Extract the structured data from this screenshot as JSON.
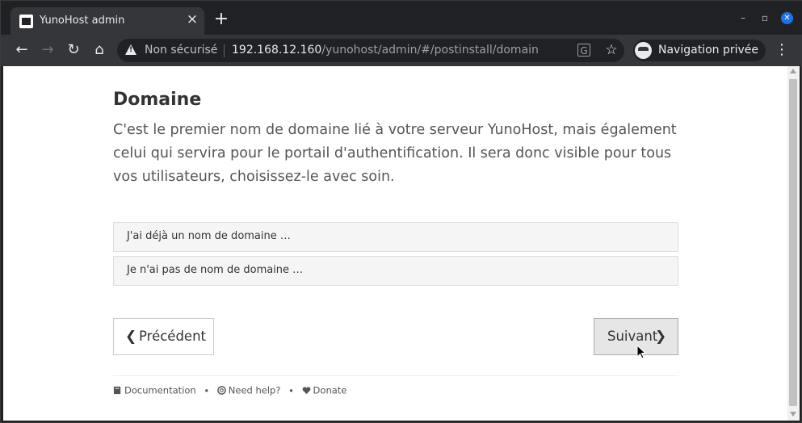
{
  "browser": {
    "tab_title": "YunoHost admin",
    "security_label": "Non sécurisé",
    "url_host": "192.168.12.160",
    "url_path": "/yunohost/admin/#/postinstall/domain",
    "incognito_label": "Navigation privée"
  },
  "page": {
    "title": "Domaine",
    "description": "C'est le premier nom de domaine lié à votre serveur YunoHost, mais également celui qui servira pour le portail d'authentification. Il sera donc visible pour tous vos utilisateurs, choisissez-le avec soin.",
    "choices": [
      {
        "label": "J'ai déjà un nom de domaine …"
      },
      {
        "label": "Je n'ai pas de nom de domaine …"
      }
    ],
    "prev_label": "Précédent",
    "next_label": "Suivant"
  },
  "footer": {
    "documentation": "Documentation",
    "help": "Need help?",
    "donate": "Donate",
    "separator": "•"
  },
  "icons": {
    "favicon": "yunohost-icon",
    "security": "warning-icon",
    "incognito": "incognito-icon",
    "documentation": "book-icon",
    "help": "life-ring-icon",
    "donate": "heart-icon"
  }
}
